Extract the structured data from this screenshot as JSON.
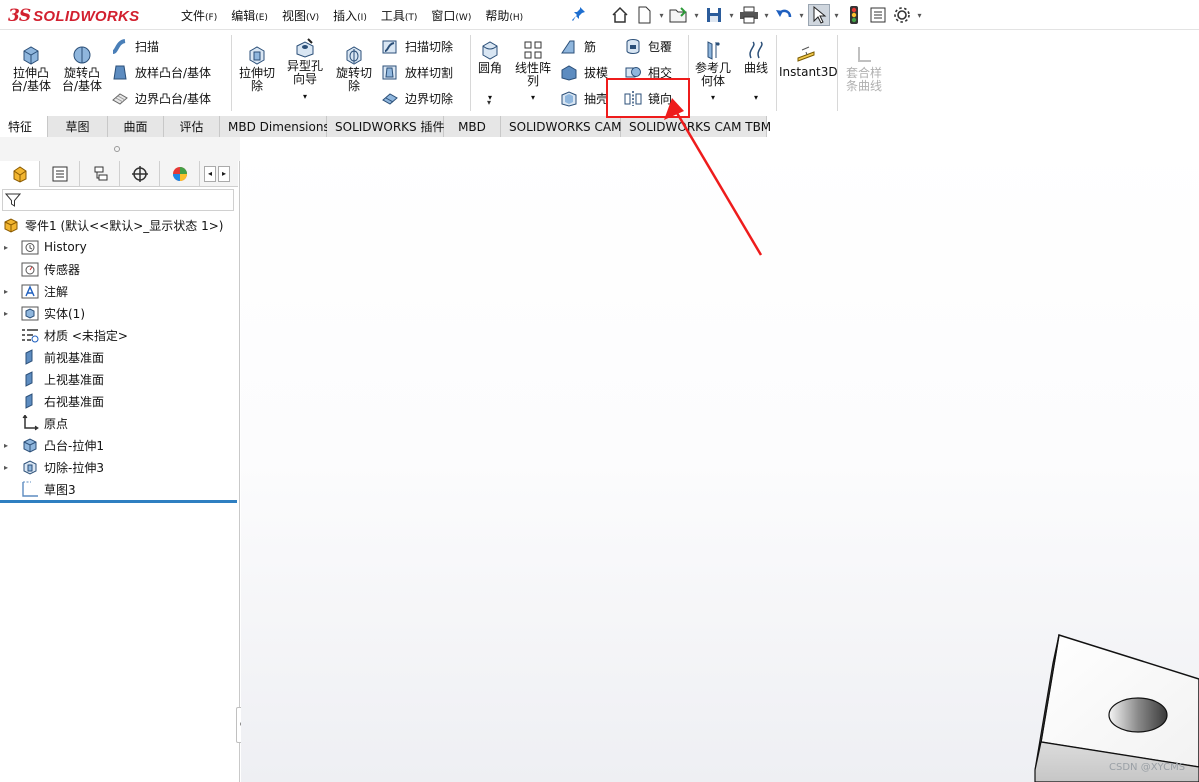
{
  "app": {
    "logo_ds": "3S",
    "logo_text": "SOLIDWORKS"
  },
  "menu": [
    {
      "label": "文件",
      "key": "(F)"
    },
    {
      "label": "编辑",
      "key": "(E)"
    },
    {
      "label": "视图",
      "key": "(V)"
    },
    {
      "label": "插入",
      "key": "(I)"
    },
    {
      "label": "工具",
      "key": "(T)"
    },
    {
      "label": "窗口",
      "key": "(W)"
    },
    {
      "label": "帮助",
      "key": "(H)"
    }
  ],
  "ribbon": {
    "extrude_boss": "拉伸凸\n台/基体",
    "revolve_boss": "旋转凸\n台/基体",
    "sweep": "扫描",
    "loft_boss": "放样凸台/基体",
    "boundary_boss": "边界凸台/基体",
    "extrude_cut": "拉伸切\n除",
    "hole_wizard": "异型孔\n向导",
    "revolve_cut": "旋转切\n除",
    "swept_cut": "扫描切除",
    "lofted_cut": "放样切割",
    "boundary_cut": "边界切除",
    "fillet": "圆角",
    "linear_pattern": "线性阵\n列",
    "rib": "筋",
    "draft": "拔模",
    "shell": "抽壳",
    "wrap": "包覆",
    "intersect": "相交",
    "mirror": "镜向",
    "ref_geometry": "参考几\n何体",
    "curves": "曲线",
    "instant3d": "Instant3D",
    "composite_curve": "套合样\n条曲线"
  },
  "tabs": [
    "特征",
    "草图",
    "曲面",
    "评估",
    "MBD Dimensions",
    "SOLIDWORKS 插件",
    "MBD",
    "SOLIDWORKS CAM",
    "SOLIDWORKS CAM TBM"
  ],
  "tree": {
    "root": "零件1 (默认<<默认>_显示状态 1>)",
    "items": [
      {
        "label": "History",
        "expand": true
      },
      {
        "label": "传感器",
        "expand": false
      },
      {
        "label": "注解",
        "expand": true
      },
      {
        "label": "实体(1)",
        "expand": true
      },
      {
        "label": "材质 <未指定>",
        "expand": false
      },
      {
        "label": "前视基准面",
        "expand": false
      },
      {
        "label": "上视基准面",
        "expand": false
      },
      {
        "label": "右视基准面",
        "expand": false
      },
      {
        "label": "原点",
        "expand": false
      },
      {
        "label": "凸台-拉伸1",
        "expand": true
      },
      {
        "label": "切除-拉伸3",
        "expand": true
      },
      {
        "label": "草图3",
        "expand": false
      }
    ]
  },
  "watermark": "CSDN @XYCMS",
  "colors": {
    "accent": "#d2202f",
    "highlight": "#ee1c1c",
    "selection": "#2f7fc1"
  }
}
